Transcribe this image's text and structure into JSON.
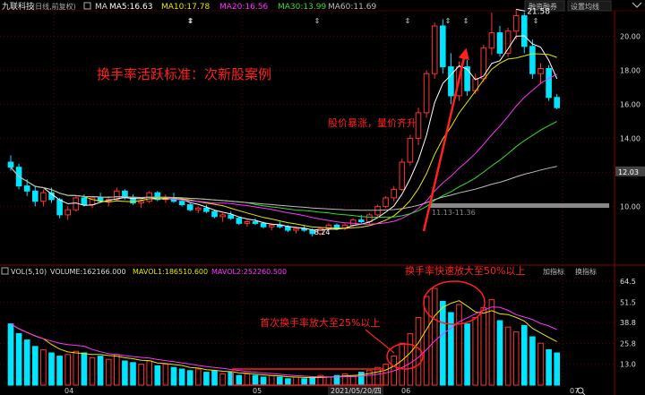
{
  "header": {
    "stock_name": "九联科技",
    "period_label": "(日线,前复权)",
    "ma_label": "MA",
    "ma5": "MA5:16.63",
    "ma10": "MA10:17.78",
    "ma20": "MA20:16.56",
    "ma30": "MA30:13.99",
    "ma60": "MA60:11.69",
    "btn_margin": "融资融券",
    "btn_settings": "设置均线"
  },
  "vol_header": {
    "vol_label": "VOL(5,10)",
    "volume": "VOLUME:162166.000",
    "mavol1": "MAVOL1:186510.600",
    "mavol2": "MAVOL2:252260.500",
    "btn_add": "加指标",
    "btn_replace": "换指标"
  },
  "annotations": {
    "title": "换手率活跃标准：次新股案例",
    "price_vol_note": "股价暴涨，量价齐升",
    "turnover_50": "换手率快速放大至50%以上",
    "turnover_25": "首次换手率放大至25%以上",
    "high_label": "21.58",
    "low_label": "8.24",
    "mid_label": "11.13-11.36",
    "current_price": "12.03",
    "date_tag": "2021/05/20/四"
  },
  "colors": {
    "up": "#ff3232",
    "down": "#00e5ff",
    "ma5": "#ffffff",
    "ma10": "#e6e600",
    "ma20": "#ff33ff",
    "ma30": "#33dd33",
    "ma60": "#bbbbbb",
    "annotation_red": "#ff2020"
  },
  "chart_data": [
    {
      "type": "candlestick",
      "title": "九联科技",
      "y_ticks": [
        "20.00",
        "18.00",
        "16.00",
        "14.00",
        "12.00",
        "10.00"
      ],
      "ylim": [
        7.6,
        22.6
      ],
      "x_ticks": [
        "04",
        "05",
        "06",
        "07"
      ],
      "candles": [
        [
          12.6,
          13.0,
          12.1,
          12.3
        ],
        [
          12.3,
          12.5,
          11.0,
          11.2
        ],
        [
          11.2,
          11.6,
          10.6,
          10.9
        ],
        [
          10.9,
          11.2,
          10.0,
          10.3
        ],
        [
          10.3,
          11.0,
          10.0,
          10.8
        ],
        [
          10.8,
          11.1,
          10.2,
          10.4
        ],
        [
          10.4,
          10.5,
          9.3,
          9.5
        ],
        [
          9.5,
          10.0,
          9.2,
          9.8
        ],
        [
          9.8,
          10.6,
          9.7,
          10.5
        ],
        [
          10.5,
          10.7,
          10.0,
          10.1
        ],
        [
          10.1,
          10.6,
          9.9,
          10.5
        ],
        [
          10.5,
          10.8,
          10.2,
          10.3
        ],
        [
          10.3,
          10.6,
          10.0,
          10.4
        ],
        [
          10.4,
          11.1,
          10.3,
          10.9
        ],
        [
          10.9,
          11.0,
          10.4,
          10.5
        ],
        [
          10.5,
          10.7,
          10.1,
          10.2
        ],
        [
          10.2,
          10.4,
          9.9,
          10.3
        ],
        [
          10.3,
          10.9,
          10.2,
          10.8
        ],
        [
          10.8,
          10.9,
          10.3,
          10.4
        ],
        [
          10.4,
          10.7,
          10.2,
          10.5
        ],
        [
          10.5,
          10.8,
          10.2,
          10.3
        ],
        [
          10.3,
          10.4,
          10.0,
          10.1
        ],
        [
          10.1,
          10.2,
          9.7,
          9.8
        ],
        [
          9.8,
          10.0,
          9.6,
          9.9
        ],
        [
          9.9,
          10.1,
          9.6,
          9.7
        ],
        [
          9.7,
          9.8,
          9.3,
          9.4
        ],
        [
          9.4,
          9.6,
          9.1,
          9.5
        ],
        [
          9.5,
          9.7,
          9.2,
          9.3
        ],
        [
          9.3,
          9.4,
          8.9,
          9.0
        ],
        [
          9.0,
          9.2,
          8.8,
          9.1
        ],
        [
          9.1,
          9.3,
          8.9,
          9.0
        ],
        [
          9.0,
          9.1,
          8.7,
          8.8
        ],
        [
          8.8,
          9.0,
          8.6,
          8.9
        ],
        [
          8.9,
          9.1,
          8.7,
          8.8
        ],
        [
          8.8,
          8.9,
          8.5,
          8.6
        ],
        [
          8.6,
          8.8,
          8.4,
          8.7
        ],
        [
          8.7,
          8.9,
          8.5,
          8.6
        ],
        [
          8.6,
          8.7,
          8.24,
          8.4
        ],
        [
          8.4,
          8.8,
          8.3,
          8.7
        ],
        [
          8.7,
          9.0,
          8.6,
          8.9
        ],
        [
          8.9,
          9.0,
          8.6,
          8.7
        ],
        [
          8.7,
          9.0,
          8.6,
          8.9
        ],
        [
          8.9,
          9.3,
          8.8,
          9.2
        ],
        [
          9.2,
          9.5,
          9.0,
          9.1
        ],
        [
          9.1,
          9.6,
          9.0,
          9.5
        ],
        [
          9.5,
          10.1,
          9.4,
          10.0
        ],
        [
          10.0,
          10.6,
          9.9,
          10.5
        ],
        [
          10.5,
          11.2,
          10.3,
          11.0
        ],
        [
          11.0,
          12.8,
          10.9,
          12.6
        ],
        [
          12.6,
          14.2,
          12.4,
          14.0
        ],
        [
          14.0,
          15.8,
          13.6,
          15.5
        ],
        [
          15.5,
          18.0,
          15.2,
          17.8
        ],
        [
          17.8,
          20.8,
          17.5,
          20.6
        ],
        [
          20.6,
          21.0,
          17.8,
          18.2
        ],
        [
          18.2,
          19.0,
          16.0,
          16.5
        ],
        [
          16.5,
          18.5,
          16.2,
          18.2
        ],
        [
          18.2,
          18.6,
          16.5,
          16.8
        ],
        [
          16.8,
          17.8,
          16.6,
          17.5
        ],
        [
          17.5,
          19.5,
          17.3,
          19.3
        ],
        [
          19.3,
          21.4,
          18.9,
          20.2
        ],
        [
          20.2,
          20.6,
          18.8,
          19.0
        ],
        [
          19.0,
          20.5,
          18.8,
          20.3
        ],
        [
          20.3,
          21.58,
          19.8,
          21.2
        ],
        [
          21.2,
          21.4,
          19.0,
          19.4
        ],
        [
          19.4,
          19.8,
          17.5,
          17.8
        ],
        [
          17.8,
          18.4,
          17.2,
          18.1
        ],
        [
          18.1,
          18.3,
          16.2,
          16.4
        ],
        [
          16.4,
          16.6,
          15.7,
          15.8
        ]
      ]
    },
    {
      "type": "bar",
      "title": "VOL(5,10)",
      "y_ticks": [
        "64.5",
        "51.5",
        "38.8",
        "25.8",
        "13.0"
      ],
      "ylim": [
        0,
        67
      ],
      "unit": "turnover %",
      "values": [
        38,
        32,
        28,
        24,
        22,
        20,
        18,
        19,
        21,
        20,
        17,
        18,
        16,
        19,
        15,
        14,
        13,
        15,
        12,
        13,
        11,
        10,
        9,
        10,
        8,
        9,
        7,
        8,
        6,
        7,
        6,
        5,
        6,
        5,
        4,
        5,
        4,
        5,
        6,
        5,
        6,
        7,
        6,
        8,
        9,
        11,
        13,
        18,
        26,
        32,
        42,
        55,
        60,
        52,
        45,
        50,
        38,
        42,
        48,
        53,
        40,
        36,
        33,
        37,
        30,
        26,
        22,
        20
      ]
    }
  ]
}
